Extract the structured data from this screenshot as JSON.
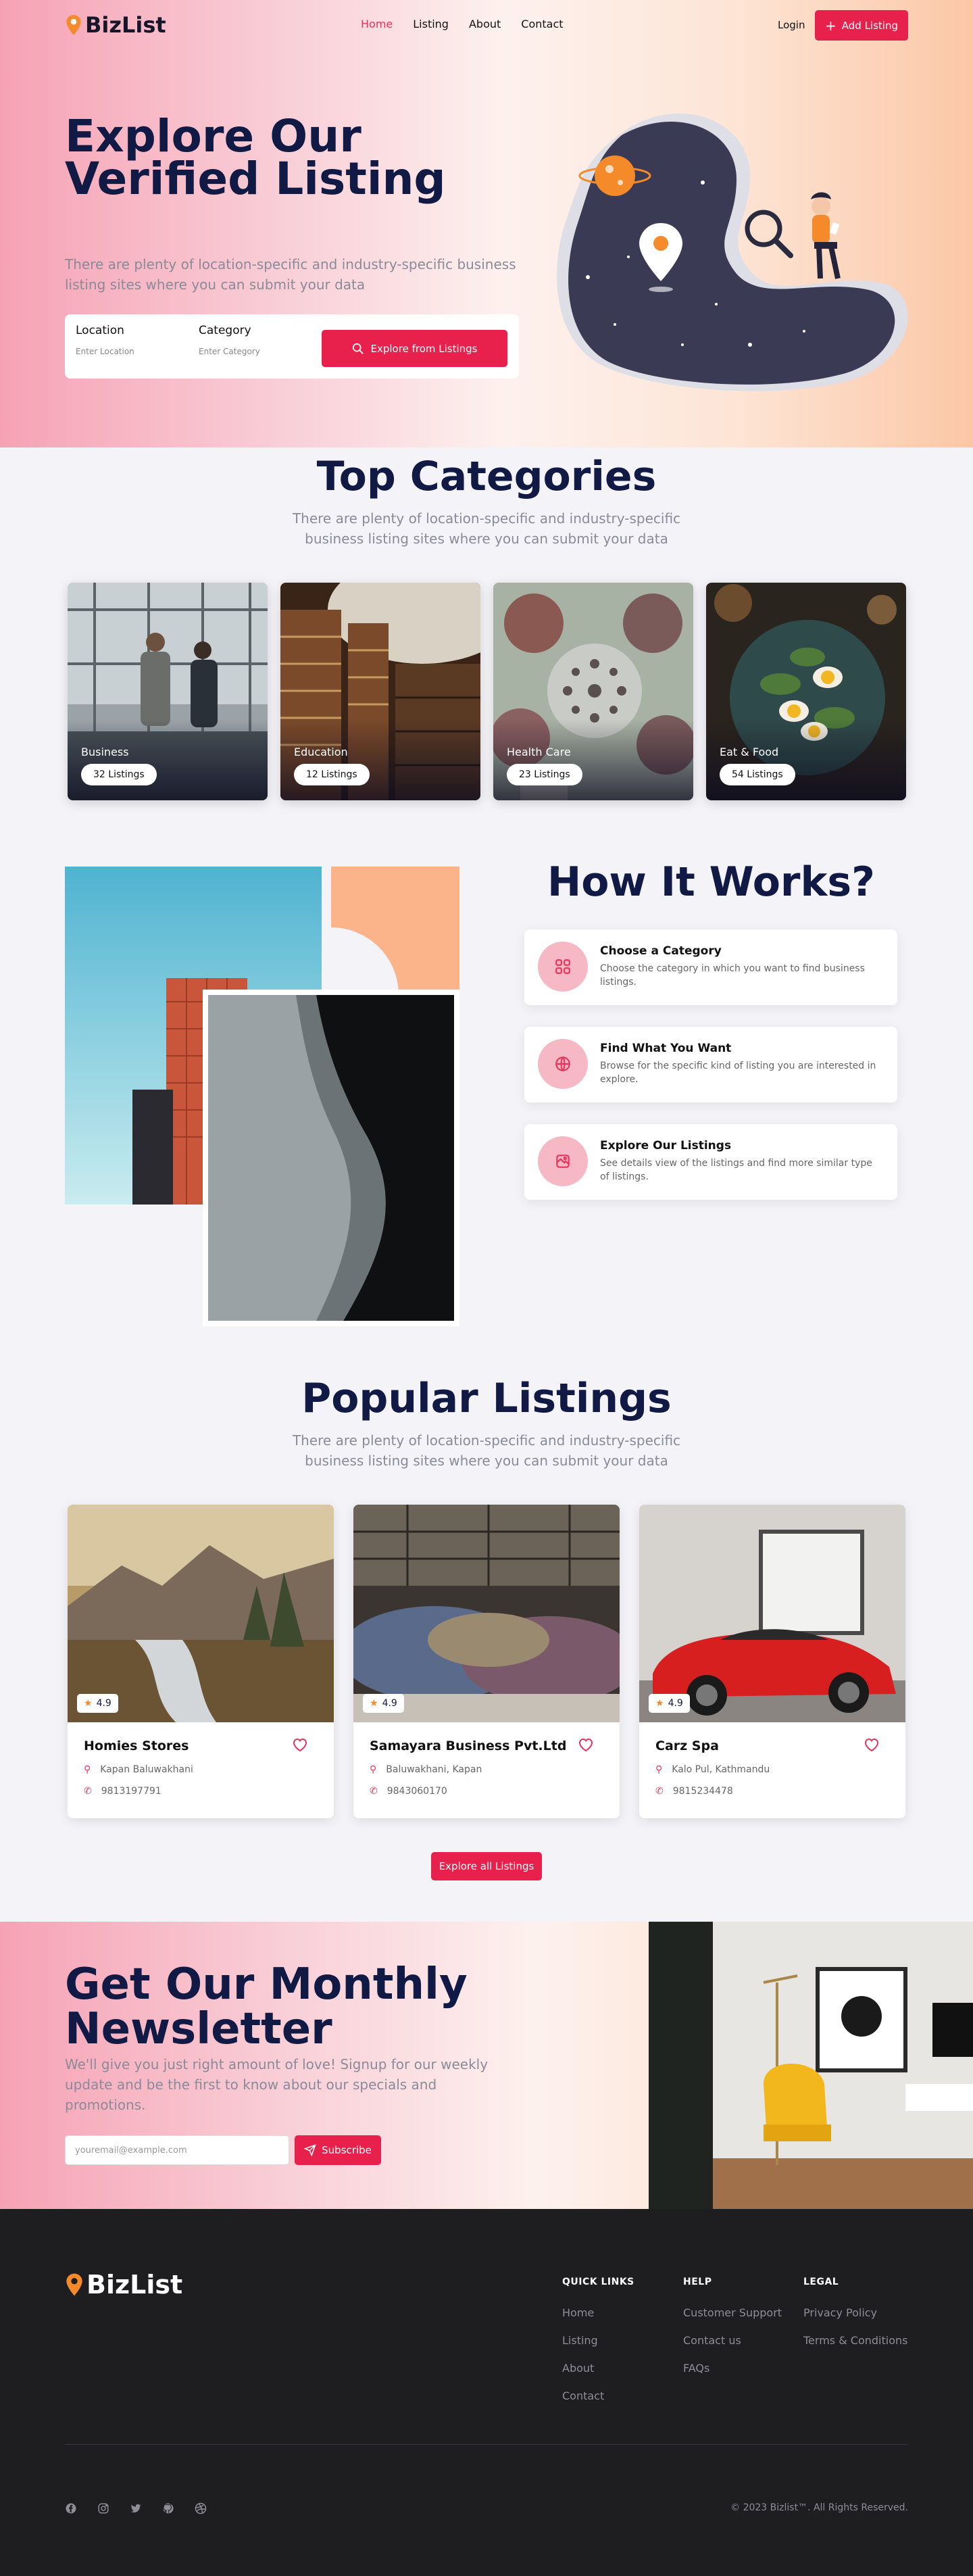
{
  "brand": {
    "name": "BizList",
    "accent": "#e8214c",
    "pin_color": "#f58a2a"
  },
  "nav": {
    "links": [
      "Home",
      "Listing",
      "About",
      "Contact"
    ],
    "active": "Home",
    "login": "Login",
    "add_listing": "Add Listing"
  },
  "hero": {
    "title": "Explore Our Verified Listing",
    "subtitle": "There are plenty of location-specific and industry-specific business listing sites where you can submit your data",
    "search": {
      "location_label": "Location",
      "location_placeholder": "Enter Location",
      "category_label": "Category",
      "category_placeholder": "Enter Category",
      "button": "Explore from Listings"
    }
  },
  "categories": {
    "title": "Top Categories",
    "subtitle": "There are plenty of location-specific and industry-specific business listing sites where you can submit your data",
    "items": [
      {
        "name": "Business",
        "count": "32 Listings"
      },
      {
        "name": "Education",
        "count": "12 Listings"
      },
      {
        "name": "Health Care",
        "count": "23 Listings"
      },
      {
        "name": "Eat & Food",
        "count": "54 Listings"
      }
    ]
  },
  "how": {
    "title": "How It Works?",
    "steps": [
      {
        "title": "Choose a Category",
        "desc": "Choose the category in which you want to find business listings.",
        "icon": "grid-icon"
      },
      {
        "title": "Find What You Want",
        "desc": "Browse for the specific kind of listing you are interested in explore.",
        "icon": "globe-icon"
      },
      {
        "title": "Explore Our Listings",
        "desc": "See details view of the listings and find more similar type of listings.",
        "icon": "map-icon"
      }
    ]
  },
  "popular": {
    "title": "Popular Listings",
    "subtitle": "There are plenty of location-specific and industry-specific business listing sites where you can submit your data",
    "items": [
      {
        "name": "Homies Stores",
        "rating": "4.9",
        "address": "Kapan Baluwakhani",
        "phone": "9813197791"
      },
      {
        "name": "Samayara Business Pvt.Ltd",
        "rating": "4.9",
        "address": "Baluwakhani, Kapan",
        "phone": "9843060170"
      },
      {
        "name": "Carz Spa",
        "rating": "4.9",
        "address": "Kalo Pul, Kathmandu",
        "phone": "9815234478"
      }
    ],
    "button": "Explore all Listings"
  },
  "newsletter": {
    "title": "Get Our Monthly Newsletter",
    "subtitle": "We'll give you just right amount of love! Signup for our weekly update and be the first to know about our specials and promotions.",
    "placeholder": "youremail@example.com",
    "button": "Subscribe"
  },
  "footer": {
    "cols": [
      {
        "heading": "QUICK LINKS",
        "items": [
          "Home",
          "Listing",
          "About",
          "Contact"
        ]
      },
      {
        "heading": "HELP",
        "items": [
          "Customer Support",
          "Contact us",
          "FAQs"
        ]
      },
      {
        "heading": "LEGAL",
        "items": [
          "Privacy Policy",
          "Terms & Conditions"
        ]
      }
    ],
    "social": [
      "facebook-icon",
      "instagram-icon",
      "twitter-icon",
      "github-icon",
      "dribbble-icon"
    ],
    "copyright": "© 2023 Bizlist™. All Rights Reserved."
  }
}
